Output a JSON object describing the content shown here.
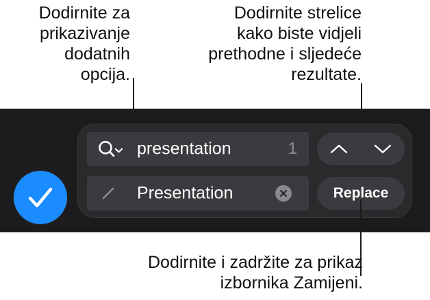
{
  "callouts": {
    "options": {
      "lines": [
        "Dodirnite za",
        "prikazivanje",
        "dodatnih",
        "opcija."
      ]
    },
    "arrows": {
      "lines": [
        "Dodirnite strelice",
        "kako biste vidjeli",
        "prethodne i sljedeće",
        "rezultate."
      ]
    },
    "replace": {
      "lines": [
        "Dodirnite i zadržite za prikaz",
        "izbornika Zamijeni."
      ]
    }
  },
  "find_bar": {
    "search_text": "presentation",
    "match_count": "1",
    "replace_text": "Presentation",
    "replace_button_label": "Replace"
  },
  "icons": {
    "search_options": "search-chevron-icon",
    "pencil": "pencil-icon",
    "clear": "clear-x-icon",
    "previous": "chevron-up-icon",
    "next": "chevron-down-icon",
    "done": "checkmark-icon"
  },
  "colors": {
    "accent": "#1a8cff",
    "band": "#1c1c1e",
    "panel": "#2a2a2d",
    "field": "#3b3b3f",
    "text_on_dark": "#ffffff",
    "secondary_text": "#8e8e93"
  }
}
